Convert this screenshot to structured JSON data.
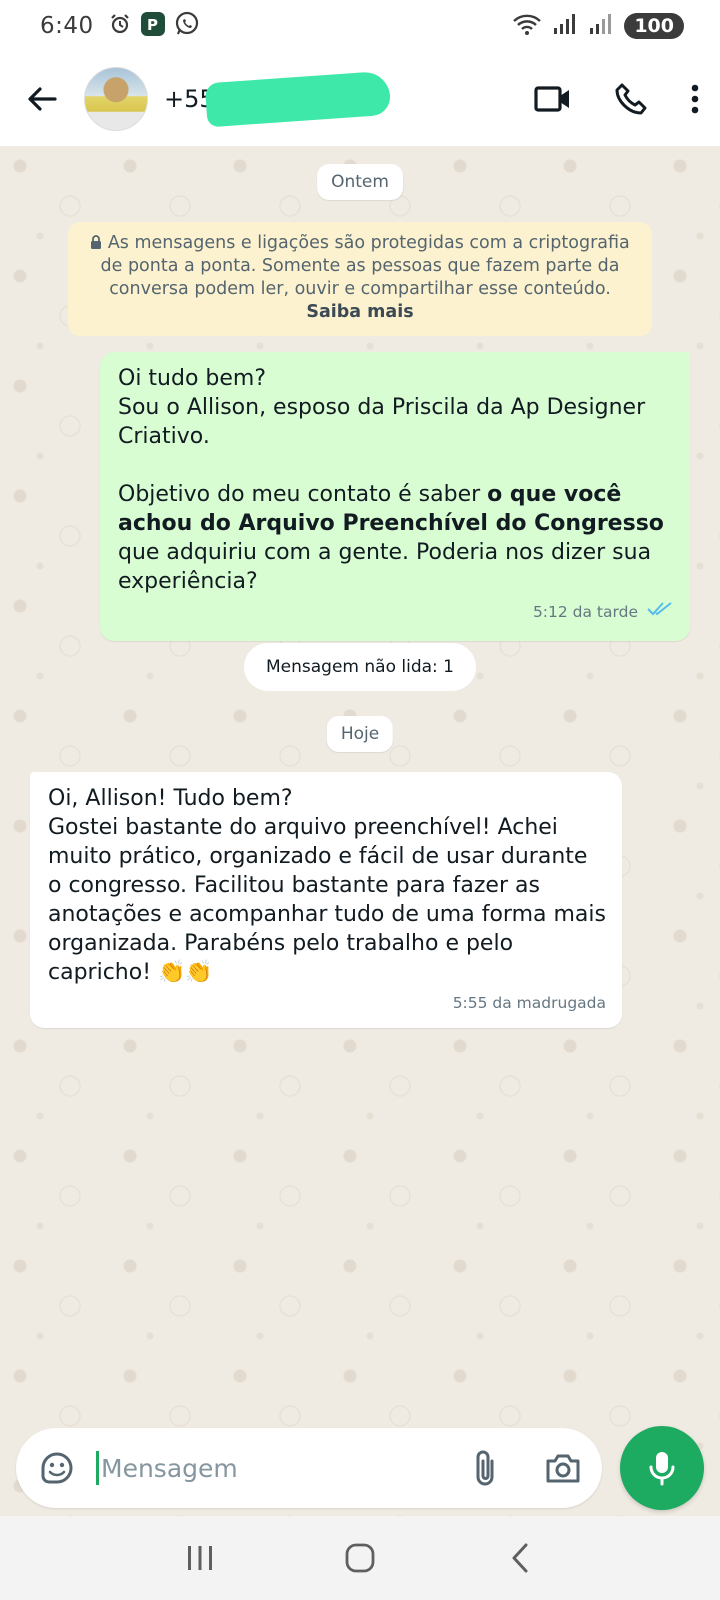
{
  "status_bar": {
    "time": "6:40",
    "battery": "100"
  },
  "header": {
    "contact_name": "+55",
    "icons": [
      "back-arrow-icon",
      "video-call-icon",
      "voice-call-icon",
      "more-options-icon"
    ]
  },
  "chat": {
    "date_yesterday": "Ontem",
    "encryption_notice": "As mensagens e ligações são protegidas com a criptografia de ponta a ponta. Somente as pessoas que fazem parte da conversa podem ler, ouvir e compartilhar esse conteúdo.",
    "encryption_learn_more": "Saiba mais",
    "outgoing_message": {
      "line1": "Oi tudo bem?",
      "line2": "Sou o Allison, esposo da Priscila da Ap Designer Criativo.",
      "line3_pre": "Objetivo do meu contato é saber ",
      "line3_bold": "o que você achou do Arquivo Preenchível do Congresso",
      "line3_post": " que adquiriu com a gente. Poderia nos dizer sua experiência?",
      "time": "5:12 da tarde",
      "status": "read"
    },
    "unread_label": "Mensagem não lida: 1",
    "date_today": "Hoje",
    "incoming_message": {
      "text": "Oi, Allison! Tudo bem?\nGostei bastante do arquivo preenchível! Achei muito prático, organizado e fácil de usar durante o congresso. Facilitou bastante para fazer as anotações e acompanhar tudo de uma forma mais organizada. Parabéns pelo trabalho e pelo capricho! 👏👏",
      "time": "5:55 da madrugada"
    }
  },
  "composer": {
    "placeholder": "Mensagem"
  },
  "colors": {
    "accent_green": "#1daa61",
    "outgoing_bubble": "#d9fdd3",
    "notice_bg": "#fdf2cf",
    "chat_bg": "#efeae2",
    "read_ticks": "#53bdeb"
  }
}
